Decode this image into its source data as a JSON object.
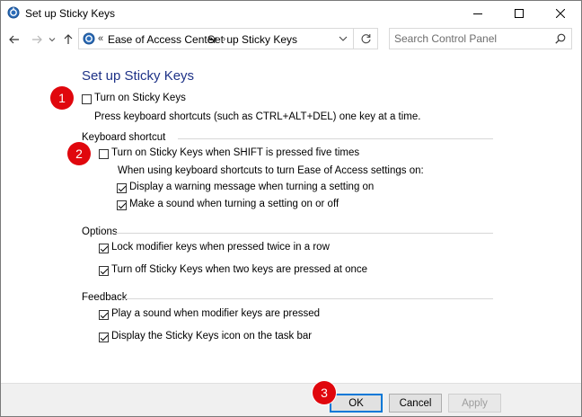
{
  "window": {
    "title": "Set up Sticky Keys"
  },
  "nav": {
    "address_overflow": "«",
    "crumbs": [
      "Ease of Access Center",
      "Set up Sticky Keys"
    ],
    "search_placeholder": "Search Control Panel"
  },
  "page": {
    "heading": "Set up Sticky Keys",
    "turn_on": {
      "label": "Turn on Sticky Keys",
      "checked": false
    },
    "turn_on_desc": "Press keyboard shortcuts (such as CTRL+ALT+DEL) one key at a time.",
    "keyboard_shortcut": {
      "title": "Keyboard shortcut",
      "shift_five": {
        "label": "Turn on Sticky Keys when SHIFT is pressed five times",
        "checked": false
      },
      "note": "When using keyboard shortcuts to turn Ease of Access settings on:",
      "warning": {
        "label": "Display a warning message when turning a setting on",
        "checked": true
      },
      "sound": {
        "label": "Make a sound when turning a setting on or off",
        "checked": true
      }
    },
    "options": {
      "title": "Options",
      "lock": {
        "label": "Lock modifier keys when pressed twice in a row",
        "checked": true
      },
      "turn_off": {
        "label": "Turn off Sticky Keys when two keys are pressed at once",
        "checked": true
      }
    },
    "feedback": {
      "title": "Feedback",
      "play_sound": {
        "label": "Play a sound when modifier keys are pressed",
        "checked": true
      },
      "taskbar_icon": {
        "label": "Display the Sticky Keys icon on the task bar",
        "checked": true
      }
    }
  },
  "badges": [
    "1",
    "2",
    "3"
  ],
  "buttons": {
    "ok": "OK",
    "cancel": "Cancel",
    "apply": "Apply"
  },
  "colors": {
    "heading": "#1e3287",
    "badge": "#e0070d",
    "accent": "#0078d7"
  }
}
